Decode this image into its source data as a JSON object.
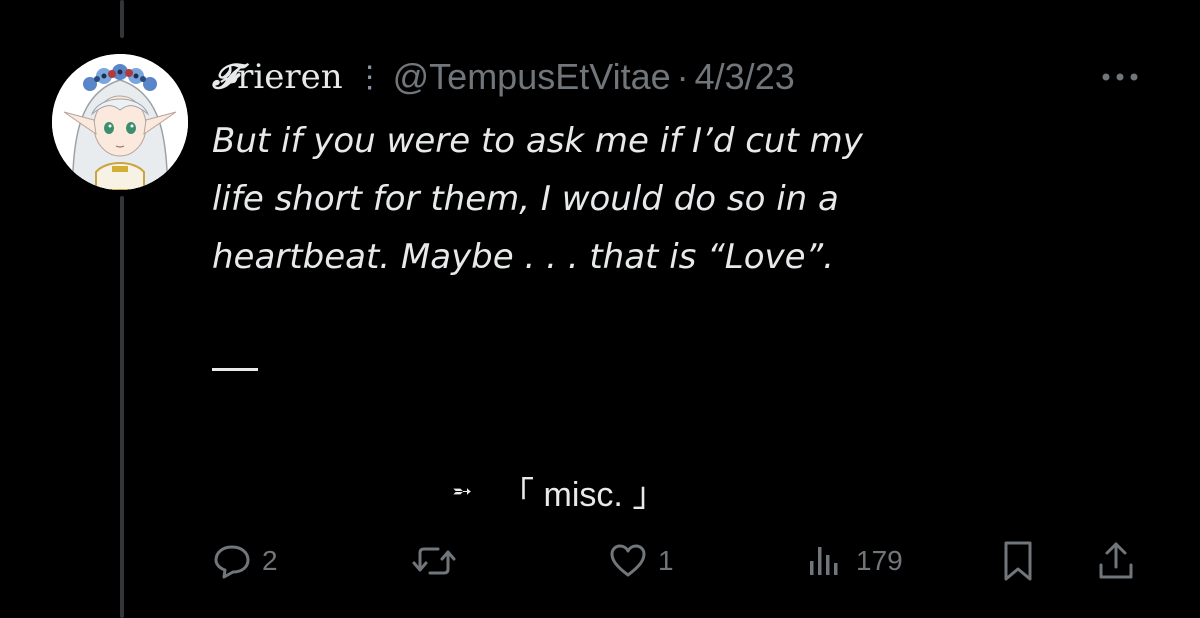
{
  "tweet": {
    "display_name_initial": "𝓕",
    "display_name_rest": "rieren",
    "name_badge": "⋮",
    "handle": "@TempusEtVitae",
    "separator": "·",
    "date": "4/3/23",
    "text_lines": [
      "But if you were to ask me if I’d cut my",
      "life short for them, I would do so in a",
      "heartbeat. Maybe . . . that is “Love”."
    ],
    "footer_arrow": "➵",
    "footer_text": "「 misc. 」"
  },
  "actions": {
    "reply_count": "2",
    "retweet_count": "",
    "like_count": "1",
    "views_count": "179"
  },
  "icons": {
    "more": "more-horizontal-icon",
    "reply": "reply-bubble-icon",
    "retweet": "retweet-icon",
    "like": "heart-icon",
    "views": "views-bar-chart-icon",
    "bookmark": "bookmark-icon",
    "share": "share-upload-icon"
  },
  "colors": {
    "background": "#000000",
    "primary_text": "#e7e9ea",
    "secondary_text": "#71767b",
    "thread_line": "#333639"
  }
}
